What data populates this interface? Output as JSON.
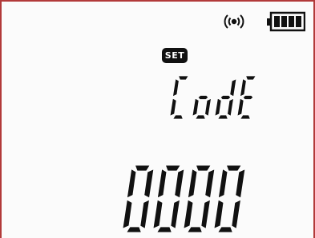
{
  "display": {
    "badge": "SET",
    "label": "CodE",
    "value": "0000"
  },
  "status": {
    "signal_icon": "wireless-signal-icon",
    "battery_icon": "battery-full-icon",
    "battery_level": 1.0
  },
  "colors": {
    "frame": "#b23a3a",
    "segment": "#111111",
    "background": "#fbfbfb"
  }
}
